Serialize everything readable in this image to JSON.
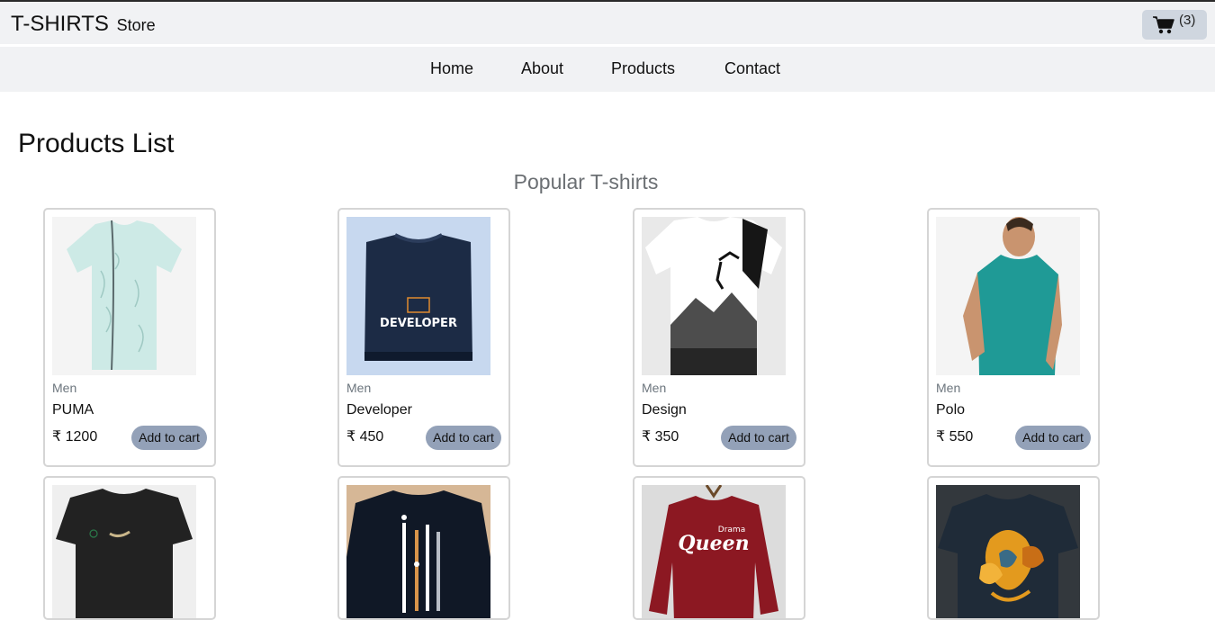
{
  "header": {
    "brand": "T-SHIRTS",
    "brand_sub": "Store",
    "cart_count": "(3)"
  },
  "nav": {
    "items": [
      "Home",
      "About",
      "Products",
      "Contact"
    ]
  },
  "main": {
    "title": "Products List",
    "section_title": "Popular T-shirts"
  },
  "products": [
    {
      "category": "Men",
      "name": "PUMA",
      "price": "₹ 1200",
      "button": "Add to cart"
    },
    {
      "category": "Men",
      "name": "Developer",
      "price": "₹ 450",
      "button": "Add to cart"
    },
    {
      "category": "Men",
      "name": "Design",
      "price": "₹ 350",
      "button": "Add to cart"
    },
    {
      "category": "Men",
      "name": "Polo",
      "price": "₹ 550",
      "button": "Add to cart"
    }
  ],
  "images": {
    "puma": "",
    "developer": "DEVELOPER",
    "design": "",
    "polo": "",
    "nike": "",
    "lines": "",
    "queen": "Queen",
    "queen_small": "Drama",
    "floral": ""
  },
  "colors": {
    "topbar": "#f1f2f4",
    "cart_button": "#cfd6df",
    "add_button": "#93a1b8"
  }
}
